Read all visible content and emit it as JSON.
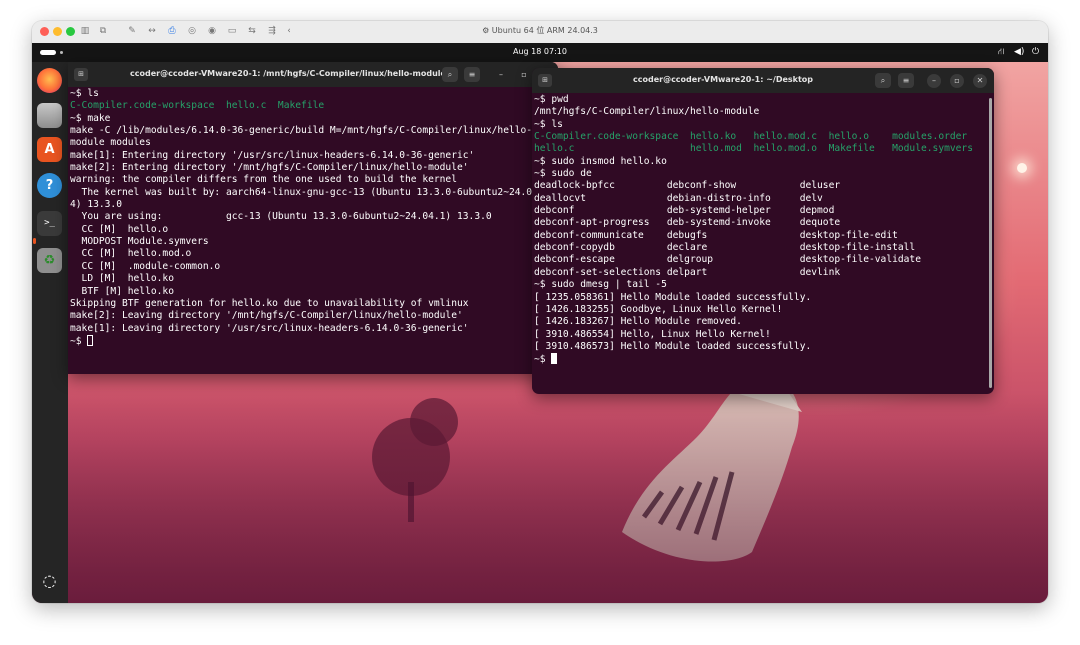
{
  "vm": {
    "title": "Ubuntu 64 位 ARM 24.04.3",
    "toolbar_icons": [
      "sidebar-icon",
      "snapshot-icon",
      "wrench-icon",
      "code-icon",
      "printer-icon",
      "camera-icon",
      "audio-icon",
      "display-icon",
      "share-icon",
      "usb-icon",
      "back-icon"
    ]
  },
  "topbar": {
    "datetime": "Aug 18  07:10",
    "tray_icons": [
      "network-icon",
      "volume-icon",
      "power-icon"
    ]
  },
  "dock": {
    "apps": [
      "Firefox",
      "Files",
      "App Center",
      "Help",
      "Terminal",
      "Trash",
      "Show Apps"
    ]
  },
  "terminal_left": {
    "title": "ccoder@ccoder-VMware20-1: /mnt/hgfs/C-Compiler/linux/hello-module",
    "lines": [
      "~$ ls",
      "C-Compiler.code-workspace  hello.c  Makefile",
      "~$ make",
      "make -C /lib/modules/6.14.0-36-generic/build M=/mnt/hgfs/C-Compiler/linux/hello-",
      "module modules",
      "make[1]: Entering directory '/usr/src/linux-headers-6.14.0-36-generic'",
      "make[2]: Entering directory '/mnt/hgfs/C-Compiler/linux/hello-module'",
      "warning: the compiler differs from the one used to build the kernel",
      "  The kernel was built by: aarch64-linux-gnu-gcc-13 (Ubuntu 13.3.0-6ubuntu2~24.0",
      "4) 13.3.0",
      "  You are using:           gcc-13 (Ubuntu 13.3.0-6ubuntu2~24.04.1) 13.3.0",
      "  CC [M]  hello.o",
      "  MODPOST Module.symvers",
      "  CC [M]  hello.mod.o",
      "  CC [M]  .module-common.o",
      "  LD [M]  hello.ko",
      "  BTF [M] hello.ko",
      "Skipping BTF generation for hello.ko due to unavailability of vmlinux",
      "make[2]: Leaving directory '/mnt/hgfs/C-Compiler/linux/hello-module'",
      "make[1]: Leaving directory '/usr/src/linux-headers-6.14.0-36-generic'",
      "~$ "
    ]
  },
  "terminal_right": {
    "title": "ccoder@ccoder-VMware20-1: ~/Desktop",
    "lines": [
      "~$ pwd",
      "/mnt/hgfs/C-Compiler/linux/hello-module",
      "~$ ls",
      "C-Compiler.code-workspace  hello.ko   hello.mod.c  hello.o    modules.order",
      "hello.c                    hello.mod  hello.mod.o  Makefile   Module.symvers",
      "~$ sudo insmod hello.ko",
      "~$ sudo de",
      "deadlock-bpfcc         debconf-show           deluser",
      "deallocvt              debian-distro-info     delv",
      "debconf                deb-systemd-helper     depmod",
      "debconf-apt-progress   deb-systemd-invoke     dequote",
      "debconf-communicate    debugfs                desktop-file-edit",
      "debconf-copydb         declare                desktop-file-install",
      "debconf-escape         delgroup               desktop-file-validate",
      "debconf-set-selections delpart                devlink",
      "~$ sudo dmesg | tail -5",
      "[ 1235.058361] Hello Module loaded successfully.",
      "[ 1426.183255] Goodbye, Linux Hello Kernel!",
      "[ 1426.183267] Hello Module removed.",
      "[ 3910.486554] Hello, Linux Hello Kernel!",
      "[ 3910.486573] Hello Module loaded successfully.",
      "~$ "
    ]
  },
  "colors": {
    "terminal_bg": "#300a24",
    "titlebar_bg": "#242424",
    "listing_green": "#26a269",
    "ubuntu_orange": "#e95420"
  }
}
